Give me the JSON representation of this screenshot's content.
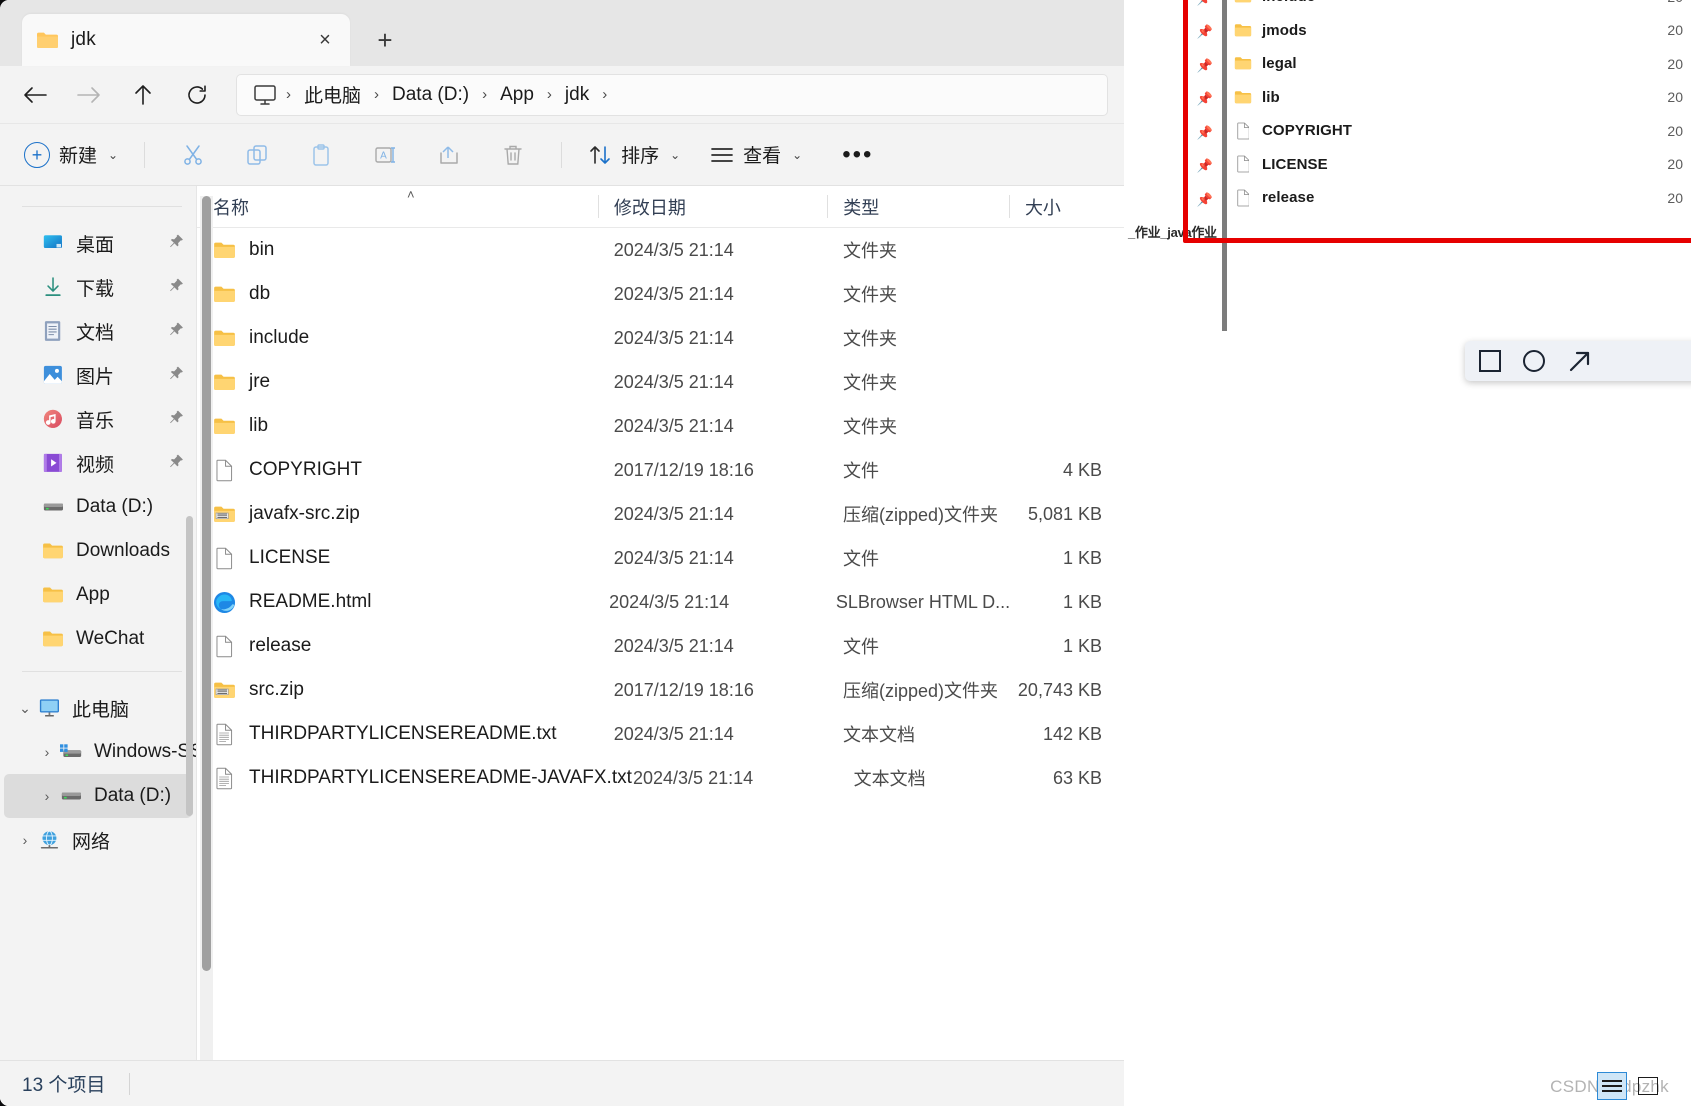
{
  "window": {
    "tab": {
      "label": "jdk",
      "icon": "folder-icon",
      "close_label": "×",
      "new_tab_label": "+"
    }
  },
  "nav": {
    "back": "←",
    "forward": "→",
    "up": "↑",
    "refresh": "↻",
    "breadcrumb": {
      "root_icon": "this-pc-icon",
      "items": [
        "此电脑",
        "Data (D:)",
        "App",
        "jdk"
      ],
      "separator": "›"
    }
  },
  "toolbar": {
    "new_label": "新建",
    "cut_icon": "scissors-icon",
    "copy_icon": "copy-icon",
    "paste_icon": "paste-icon",
    "rename_icon": "rename-icon",
    "share_icon": "share-icon",
    "delete_icon": "trash-icon",
    "sort_label": "排序",
    "view_label": "查看",
    "more_label": "•••",
    "chevron": "⌄"
  },
  "sidebar": {
    "quick_access": [
      {
        "label": "桌面",
        "icon": "desktop-icon",
        "pinned": true
      },
      {
        "label": "下载",
        "icon": "downloads-icon",
        "pinned": true
      },
      {
        "label": "文档",
        "icon": "documents-icon",
        "pinned": true
      },
      {
        "label": "图片",
        "icon": "pictures-icon",
        "pinned": true
      },
      {
        "label": "音乐",
        "icon": "music-icon",
        "pinned": true
      },
      {
        "label": "视频",
        "icon": "videos-icon",
        "pinned": true
      },
      {
        "label": "Data (D:)",
        "icon": "drive-icon",
        "pinned": false
      },
      {
        "label": "Downloads",
        "icon": "folder-icon",
        "pinned": false
      },
      {
        "label": "App",
        "icon": "folder-icon",
        "pinned": false
      },
      {
        "label": "WeChat",
        "icon": "folder-icon",
        "pinned": false
      }
    ],
    "tree": [
      {
        "label": "此电脑",
        "icon": "this-pc-icon",
        "expander": "⌄",
        "indent": 0,
        "selected": false
      },
      {
        "label": "Windows-SSD",
        "icon": "ssd-drive-icon",
        "expander": "›",
        "indent": 1,
        "selected": false
      },
      {
        "label": "Data (D:)",
        "icon": "drive-icon",
        "expander": "›",
        "indent": 1,
        "selected": true
      },
      {
        "label": "网络",
        "icon": "network-icon",
        "expander": "›",
        "indent": 0,
        "selected": false
      }
    ]
  },
  "file_list": {
    "columns": [
      {
        "key": "name",
        "label": "名称",
        "sorted": true,
        "sort_caret": "˄"
      },
      {
        "key": "date",
        "label": "修改日期"
      },
      {
        "key": "type",
        "label": "类型"
      },
      {
        "key": "size",
        "label": "大小"
      }
    ],
    "rows": [
      {
        "name": "bin",
        "icon": "folder-icon",
        "date": "2024/3/5 21:14",
        "type": "文件夹",
        "size": ""
      },
      {
        "name": "db",
        "icon": "folder-icon",
        "date": "2024/3/5 21:14",
        "type": "文件夹",
        "size": ""
      },
      {
        "name": "include",
        "icon": "folder-icon",
        "date": "2024/3/5 21:14",
        "type": "文件夹",
        "size": ""
      },
      {
        "name": "jre",
        "icon": "folder-icon",
        "date": "2024/3/5 21:14",
        "type": "文件夹",
        "size": ""
      },
      {
        "name": "lib",
        "icon": "folder-icon",
        "date": "2024/3/5 21:14",
        "type": "文件夹",
        "size": ""
      },
      {
        "name": "COPYRIGHT",
        "icon": "file-icon",
        "date": "2017/12/19 18:16",
        "type": "文件",
        "size": "4 KB"
      },
      {
        "name": "javafx-src.zip",
        "icon": "zip-icon",
        "date": "2024/3/5 21:14",
        "type": "压缩(zipped)文件夹",
        "size": "5,081 KB"
      },
      {
        "name": "LICENSE",
        "icon": "file-icon",
        "date": "2024/3/5 21:14",
        "type": "文件",
        "size": "1 KB"
      },
      {
        "name": "README.html",
        "icon": "edge-browser-icon",
        "date": "2024/3/5 21:14",
        "type": "SLBrowser HTML D...",
        "size": "1 KB"
      },
      {
        "name": "release",
        "icon": "file-icon",
        "date": "2024/3/5 21:14",
        "type": "文件",
        "size": "1 KB"
      },
      {
        "name": "src.zip",
        "icon": "zip-icon",
        "date": "2017/12/19 18:16",
        "type": "压缩(zipped)文件夹",
        "size": "20,743 KB"
      },
      {
        "name": "THIRDPARTYLICENSEREADME.txt",
        "icon": "text-file-icon",
        "date": "2024/3/5 21:14",
        "type": "文本文档",
        "size": "142 KB"
      },
      {
        "name": "THIRDPARTYLICENSEREADME-JAVAFX.txt",
        "icon": "text-file-icon",
        "date": "2024/3/5 21:14",
        "type": "文本文档",
        "size": "63 KB"
      }
    ]
  },
  "status": {
    "item_count": "13 个项目"
  },
  "background_window": {
    "rows": [
      {
        "name": "include",
        "icon": "folder-icon",
        "date": "20"
      },
      {
        "name": "jmods",
        "icon": "folder-icon",
        "date": "20"
      },
      {
        "name": "legal",
        "icon": "folder-icon",
        "date": "20"
      },
      {
        "name": "lib",
        "icon": "folder-icon",
        "date": "20"
      },
      {
        "name": "COPYRIGHT",
        "icon": "file-icon",
        "date": "20"
      },
      {
        "name": "LICENSE",
        "icon": "file-icon",
        "date": "20"
      },
      {
        "name": "release",
        "icon": "file-icon",
        "date": "20"
      }
    ],
    "path_label": "_作业_java作业",
    "pin_icon": "pin-icon",
    "highlight_color": "#e60000"
  },
  "shape_toolbar": {
    "rectangle_icon": "rectangle-shape-icon",
    "ellipse_icon": "ellipse-shape-icon",
    "arrow_icon": "arrow-shape-icon"
  },
  "watermark": {
    "text": "CSDN @dpzhk"
  },
  "view_buttons": {
    "details_icon": "details-view-icon",
    "large_icons_icon": "large-icons-view-icon"
  }
}
